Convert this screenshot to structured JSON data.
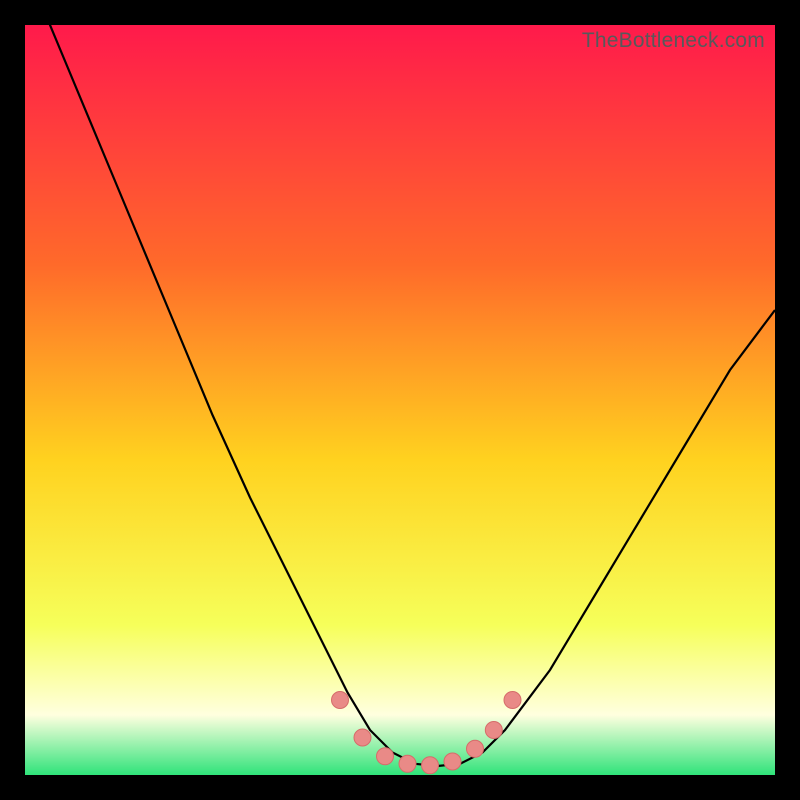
{
  "attribution": "TheBottleneck.com",
  "colors": {
    "frame": "#000000",
    "gradient_top": "#ff1a4b",
    "gradient_mid_upper": "#ff6a2a",
    "gradient_mid": "#ffd21f",
    "gradient_lower": "#f6ff5a",
    "gradient_pale": "#ffffdf",
    "gradient_green": "#2fe37a",
    "curve": "#000000",
    "marker_fill": "#e98a87",
    "marker_stroke": "#d66c6a"
  },
  "chart_data": {
    "type": "line",
    "title": "",
    "xlabel": "",
    "ylabel": "",
    "xlim": [
      0,
      100
    ],
    "ylim": [
      0,
      100
    ],
    "series": [
      {
        "name": "bottleneck-curve",
        "x": [
          0,
          5,
          10,
          15,
          20,
          25,
          30,
          35,
          40,
          43,
          46,
          49,
          52,
          55,
          58,
          61,
          64,
          70,
          76,
          82,
          88,
          94,
          100
        ],
        "y": [
          108,
          96,
          84,
          72,
          60,
          48,
          37,
          27,
          17,
          11,
          6,
          3,
          1.5,
          1.2,
          1.5,
          3,
          6,
          14,
          24,
          34,
          44,
          54,
          62
        ]
      }
    ],
    "markers": {
      "name": "points",
      "x": [
        42,
        45,
        48,
        51,
        54,
        57,
        60,
        62.5,
        65
      ],
      "y": [
        10,
        5,
        2.5,
        1.5,
        1.3,
        1.8,
        3.5,
        6,
        10
      ]
    }
  }
}
